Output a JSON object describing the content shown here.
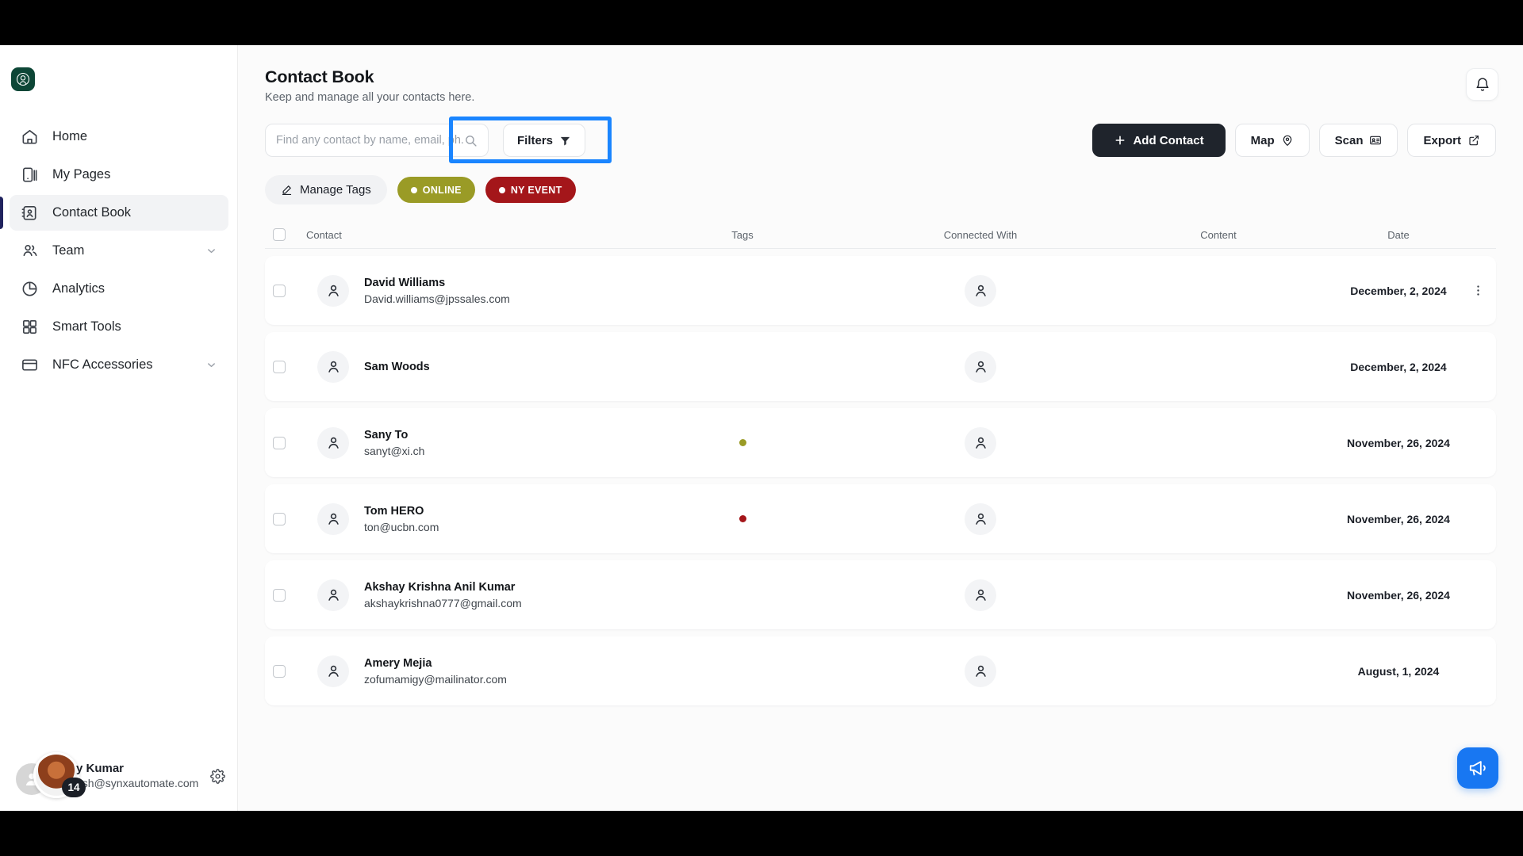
{
  "sidebar": {
    "brand_icon": "starbucks-logo-icon",
    "items": [
      {
        "label": "Home",
        "icon": "home-icon",
        "active": false,
        "chevron": false
      },
      {
        "label": "My Pages",
        "icon": "pages-icon",
        "active": false,
        "chevron": false
      },
      {
        "label": "Contact Book",
        "icon": "contact-book-icon",
        "active": true,
        "chevron": false
      },
      {
        "label": "Team",
        "icon": "team-icon",
        "active": false,
        "chevron": true
      },
      {
        "label": "Analytics",
        "icon": "analytics-pie-icon",
        "active": false,
        "chevron": false
      },
      {
        "label": "Smart Tools",
        "icon": "grid-icon",
        "active": false,
        "chevron": false
      },
      {
        "label": "NFC Accessories",
        "icon": "card-icon",
        "active": false,
        "chevron": true
      }
    ],
    "profile": {
      "name": "y Kumar",
      "email": "ash@synxautomate.com",
      "badge": "14",
      "settings_icon": "gear-icon"
    }
  },
  "header": {
    "title": "Contact Book",
    "subtitle": "Keep and manage all your contacts here.",
    "notification_icon": "bell-icon"
  },
  "search": {
    "placeholder": "Find any contact by name, email, ph...",
    "value": "",
    "icon": "search-icon"
  },
  "filters": {
    "label": "Filters",
    "icon": "funnel-icon",
    "highlight_color": "#1a85ff"
  },
  "actions": [
    {
      "label": "Add Contact",
      "icon": "plus-icon",
      "primary": true
    },
    {
      "label": "Map",
      "icon": "map-pin-icon",
      "primary": false
    },
    {
      "label": "Scan",
      "icon": "id-card-icon",
      "primary": false
    },
    {
      "label": "Export",
      "icon": "export-icon",
      "primary": false
    }
  ],
  "tags_bar": {
    "manage": {
      "label": "Manage Tags",
      "icon": "pencil-icon"
    },
    "tags": [
      {
        "label": "ONLINE",
        "color": "#9a9b26"
      },
      {
        "label": "NY EVENT",
        "color": "#a4161a"
      }
    ]
  },
  "table": {
    "columns": [
      "Contact",
      "Tags",
      "Connected With",
      "Content",
      "Date"
    ],
    "rows": [
      {
        "name": "David Williams",
        "email": "David.williams@jpssales.com",
        "tag_color": "",
        "connected": true,
        "content": "",
        "date": "December, 2, 2024",
        "menu": true
      },
      {
        "name": "Sam Woods",
        "email": "",
        "tag_color": "",
        "connected": true,
        "content": "",
        "date": "December, 2, 2024",
        "menu": false
      },
      {
        "name": "Sany To",
        "email": "sanyt@xi.ch",
        "tag_color": "#9a9b26",
        "connected": true,
        "content": "",
        "date": "November, 26, 2024",
        "menu": false
      },
      {
        "name": "Tom HERO",
        "email": "ton@ucbn.com",
        "tag_color": "#a4161a",
        "connected": true,
        "content": "",
        "date": "November, 26, 2024",
        "menu": false
      },
      {
        "name": "Akshay Krishna Anil Kumar",
        "email": "akshaykrishna0777@gmail.com",
        "tag_color": "",
        "connected": true,
        "content": "",
        "date": "November, 26, 2024",
        "menu": false
      },
      {
        "name": "Amery Mejia",
        "email": "zofumamigy@mailinator.com",
        "tag_color": "",
        "connected": true,
        "content": "",
        "date": "August, 1, 2024",
        "menu": false
      }
    ]
  },
  "chat_fab": {
    "icon": "megaphone-icon",
    "color": "#1877f2"
  }
}
